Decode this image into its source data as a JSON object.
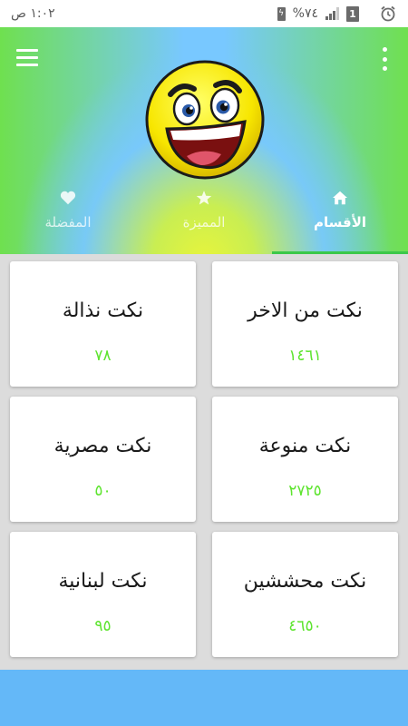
{
  "status_bar": {
    "time": "١:٠٢ ص",
    "battery": "%٧٤",
    "sim": "1"
  },
  "header": {
    "menu_icon": "hamburger-menu-icon",
    "more_icon": "more-vertical-icon",
    "mascot": "smiley-face-icon"
  },
  "tabs": [
    {
      "label": "المفضلة",
      "icon": "heart-icon",
      "active": false
    },
    {
      "label": "المميزة",
      "icon": "star-icon",
      "active": false
    },
    {
      "label": "الأقسام",
      "icon": "home-icon",
      "active": true
    }
  ],
  "categories": [
    {
      "title": "نكت من الاخر",
      "count": "١٤٦١"
    },
    {
      "title": "نكت نذالة",
      "count": "٧٨"
    },
    {
      "title": "نكت منوعة",
      "count": "٢٧٢٥"
    },
    {
      "title": "نكت مصرية",
      "count": "٥٠"
    },
    {
      "title": "نكت محششين",
      "count": "٤٦٥٠"
    },
    {
      "title": "نكت لبنانية",
      "count": "٩٥"
    }
  ],
  "colors": {
    "accent_green": "#5ee42f",
    "tab_indicator": "#3cc84a",
    "bottom_bar": "#64b8f8"
  }
}
